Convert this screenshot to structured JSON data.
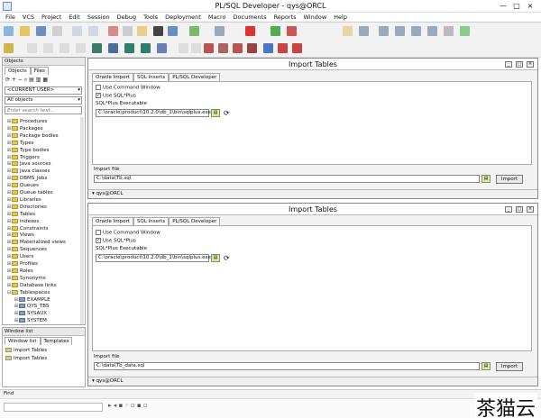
{
  "window": {
    "title": "PL/SQL Developer - qys@ORCL",
    "controls": [
      "—",
      "□",
      "×"
    ]
  },
  "menu": [
    "File",
    "VCS",
    "Project",
    "Edit",
    "Session",
    "Debug",
    "Tools",
    "Deployment",
    "Macro",
    "Documents",
    "Reports",
    "Window",
    "Help"
  ],
  "objects_pane": {
    "header": "Objects",
    "tabs": [
      "Objects",
      "Files"
    ],
    "user_combo": "<CURRENT USER>",
    "filter_combo": "All objects",
    "search_placeholder": "Enter search text...",
    "tree": [
      {
        "label": "Procedures",
        "depth": 0
      },
      {
        "label": "Packages",
        "depth": 0
      },
      {
        "label": "Package bodies",
        "depth": 0
      },
      {
        "label": "Types",
        "depth": 0
      },
      {
        "label": "Type bodies",
        "depth": 0
      },
      {
        "label": "Triggers",
        "depth": 0
      },
      {
        "label": "Java sources",
        "depth": 0
      },
      {
        "label": "Java classes",
        "depth": 0
      },
      {
        "label": "DBMS_Jobs",
        "depth": 0
      },
      {
        "label": "Queues",
        "depth": 0
      },
      {
        "label": "Queue tables",
        "depth": 0
      },
      {
        "label": "Libraries",
        "depth": 0
      },
      {
        "label": "Directories",
        "depth": 0
      },
      {
        "label": "Tables",
        "depth": 0
      },
      {
        "label": "Indexes",
        "depth": 0
      },
      {
        "label": "Constraints",
        "depth": 0
      },
      {
        "label": "Views",
        "depth": 0
      },
      {
        "label": "Materialized views",
        "depth": 0
      },
      {
        "label": "Sequences",
        "depth": 0
      },
      {
        "label": "Users",
        "depth": 0
      },
      {
        "label": "Profiles",
        "depth": 0
      },
      {
        "label": "Roles",
        "depth": 0
      },
      {
        "label": "Synonyms",
        "depth": 0
      },
      {
        "label": "Database links",
        "depth": 0
      },
      {
        "label": "Tablespaces",
        "depth": 0,
        "expanded": true
      },
      {
        "label": "EXAMPLE",
        "depth": 1
      },
      {
        "label": "QYS_TBS",
        "depth": 1
      },
      {
        "label": "SYSAUX",
        "depth": 1
      },
      {
        "label": "SYSTEM",
        "depth": 1
      }
    ]
  },
  "window_list": {
    "header": "Window list",
    "tabs": [
      "Window list",
      "Templates"
    ],
    "items": [
      "Import Tables",
      "Import Tables"
    ]
  },
  "import_windows": [
    {
      "title": "Import Tables",
      "tabs": [
        "Oracle Import",
        "SQL Inserts",
        "PL/SQL Developer"
      ],
      "use_command_window": "Use Command Window",
      "use_sqlplus": "Use SQL*Plus",
      "exe_label": "SQL*Plus Executable",
      "exe_path": "C:\\oracle\\product\\10.2.0\\db_1\\bin\\sqlplus.exe",
      "import_file_label": "Import file",
      "import_file": "C:\\data\\Tb.sql",
      "import_button": "Import",
      "connection": "qys@ORCL"
    },
    {
      "title": "Import Tables",
      "tabs": [
        "Oracle Import",
        "SQL Inserts",
        "PL/SQL Developer"
      ],
      "use_command_window": "Use Command Window",
      "use_sqlplus": "Use SQL*Plus",
      "exe_label": "SQL*Plus Executable",
      "exe_path": "C:\\oracle\\product\\10.2.0\\db_1\\bin\\sqlplus.exe",
      "import_file_label": "Import file",
      "import_file": "C:\\data\\Tb_data.sql",
      "import_button": "Import",
      "connection": "qys@ORCL"
    }
  ],
  "find_label": "Find",
  "watermark": "茶猫云"
}
